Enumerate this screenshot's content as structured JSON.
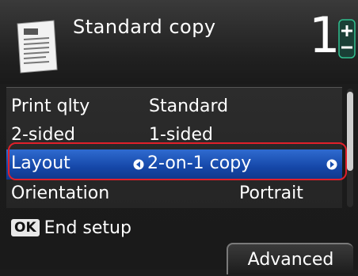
{
  "header": {
    "icon": "document-icon",
    "title": "Standard copy",
    "copies": "1",
    "stepper_icon": "plus-minus-icon"
  },
  "settings": [
    {
      "label": "Print qlty",
      "value": "Standard"
    },
    {
      "label": "2-sided",
      "value": "1-sided"
    },
    {
      "label": "Layout",
      "value": "2-on-1 copy",
      "selected": true
    },
    {
      "label": "Orientation",
      "value": "Portrait"
    }
  ],
  "footer": {
    "ok_badge": "OK",
    "ok_label": "End setup",
    "advanced_label": "Advanced"
  },
  "colors": {
    "selected_row": "#1e55c0",
    "highlight_border": "#e0202a",
    "stepper_accent": "#2fbf8f"
  }
}
